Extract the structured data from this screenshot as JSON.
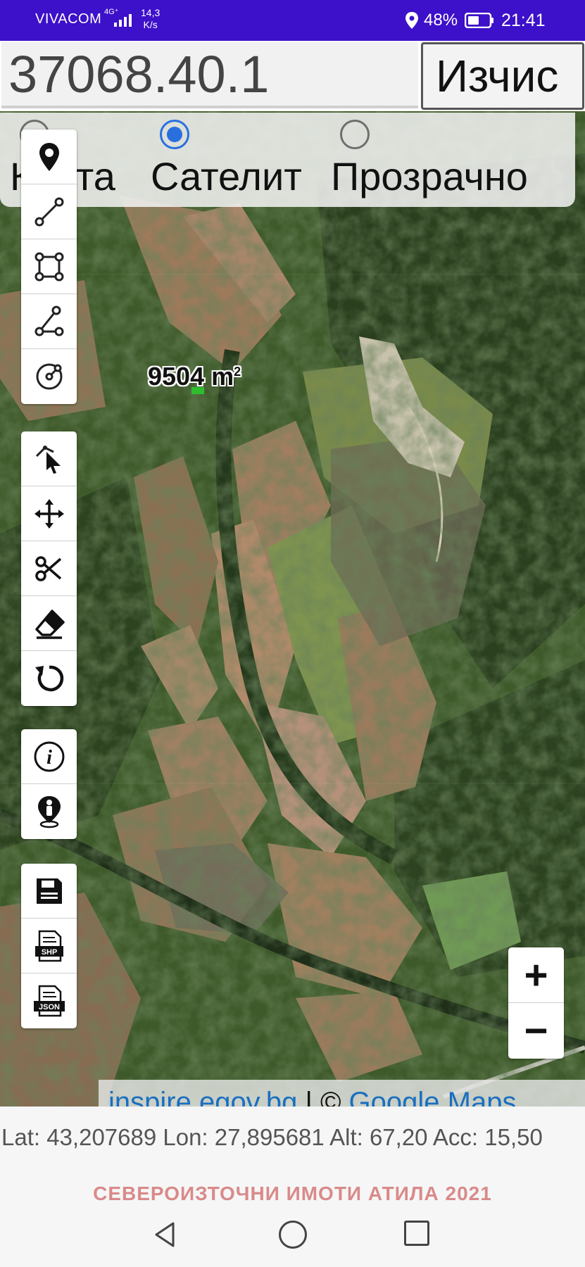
{
  "status_bar": {
    "carrier": "VIVACOM",
    "network_type": "4G⁺",
    "speed_value": "14,3",
    "speed_unit": "K/s",
    "battery": "48%",
    "time": "21:41",
    "icons": [
      "signal-icon",
      "location-icon",
      "battery-icon"
    ]
  },
  "search": {
    "value": "37068.40.1",
    "button_label": "Изчис"
  },
  "layers": {
    "options": [
      {
        "label": "Карта",
        "checked": false
      },
      {
        "label": "Сателит",
        "checked": true
      },
      {
        "label": "Прозрачно",
        "checked": false
      }
    ]
  },
  "tools": {
    "draw": [
      "marker-icon",
      "line-icon",
      "polygon-icon",
      "angle-icon",
      "circle-icon"
    ],
    "edit": [
      "select-pointer-icon",
      "move-icon",
      "cut-icon",
      "eraser-icon",
      "rotate-icon"
    ],
    "info": [
      "info-icon",
      "person-location-icon"
    ],
    "export": [
      "save-icon",
      "shp-file-icon",
      "json-file-icon"
    ],
    "shp_label": "SHP",
    "json_label": "JSON"
  },
  "map": {
    "area_value": "9504 m",
    "area_unit_power": "2",
    "attribution_link1": "inspire.egov.bg",
    "attribution_sep": " | © ",
    "attribution_link2": "Google Maps"
  },
  "zoom": {
    "in_label": "+",
    "out_label": "−"
  },
  "footer": {
    "coordinates": "Lat: 43,207689 Lon: 27,895681 Alt: 67,20 Acc: 15,50",
    "company": "СЕВЕРОИЗТОЧНИ ИМОТИ АТИЛА 2021"
  },
  "colors": {
    "status_bar": "#3d10c9",
    "radio_accent": "#2a6fe0",
    "company_text": "#d98a8a",
    "link": "#1a6fbf"
  }
}
